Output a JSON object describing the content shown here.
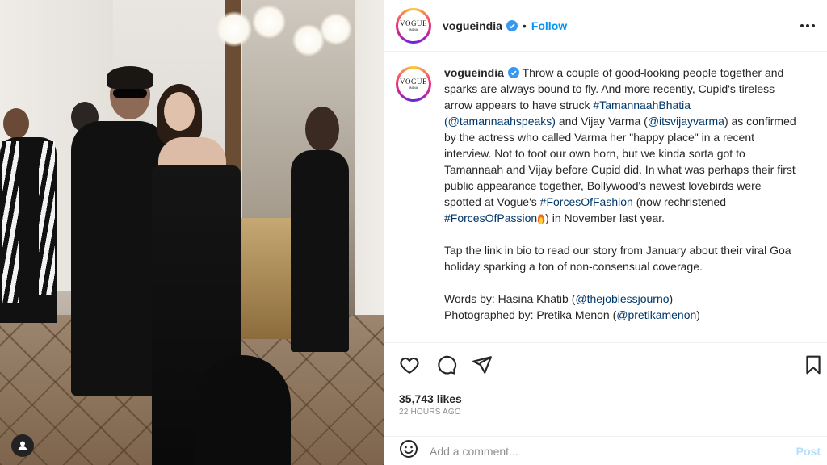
{
  "post": {
    "account": "vogueindia",
    "avatar_logo": "VOGUE",
    "avatar_sub": "INDIA",
    "follow_label": "Follow",
    "separator": "•"
  },
  "caption": {
    "user": "vogueindia",
    "p1_parts": [
      " Throw a couple of good-looking people together and sparks are always bound to fly. And more recently, Cupid's tireless arrow appears to have struck ",
      "#TamannaahBhatia",
      " ",
      "(@tamannaahspeaks)",
      " and Vijay Varma (",
      "@itsvijayvarma",
      ") as confirmed by the actress who called Varma her \"happy place\" in a recent interview. Not to toot our own horn, but we kinda sorta got to Tamannaah and Vijay before Cupid did. In what was perhaps their first public appearance together, Bollywood's newest lovebirds were spotted at Vogue's ",
      "#ForcesOfFashion",
      " (now rechristened ",
      "#ForcesOfPassion",
      ") in November last year."
    ],
    "p2": "Tap the link in bio to read our story from January about their viral Goa holiday sparking a ton of non-consensual coverage.",
    "words_label": "Words by: Hasina Khatib (",
    "words_handle": "@thejoblessjourno",
    "words_close": ")",
    "photo_label": "Photographed by: Pretika Menon (",
    "photo_handle": "@pretikamenon",
    "photo_close": ")"
  },
  "stats": {
    "likes": "35,743 likes",
    "time": "22 HOURS AGO"
  },
  "comment": {
    "placeholder": "Add a comment...",
    "post_label": "Post"
  },
  "colors": {
    "follow_blue": "#0095f6",
    "link_navy": "#00376b",
    "post_disabled": "#b2dffc",
    "verified_blue": "#3897f0"
  },
  "icons": {
    "header": [
      "verified-badge-icon",
      "more-options-icon"
    ],
    "actions": [
      "heart-icon",
      "comment-icon",
      "share-icon",
      "bookmark-icon"
    ],
    "comment": [
      "emoji-icon"
    ],
    "caption": [
      "fire-emoji-icon"
    ]
  }
}
